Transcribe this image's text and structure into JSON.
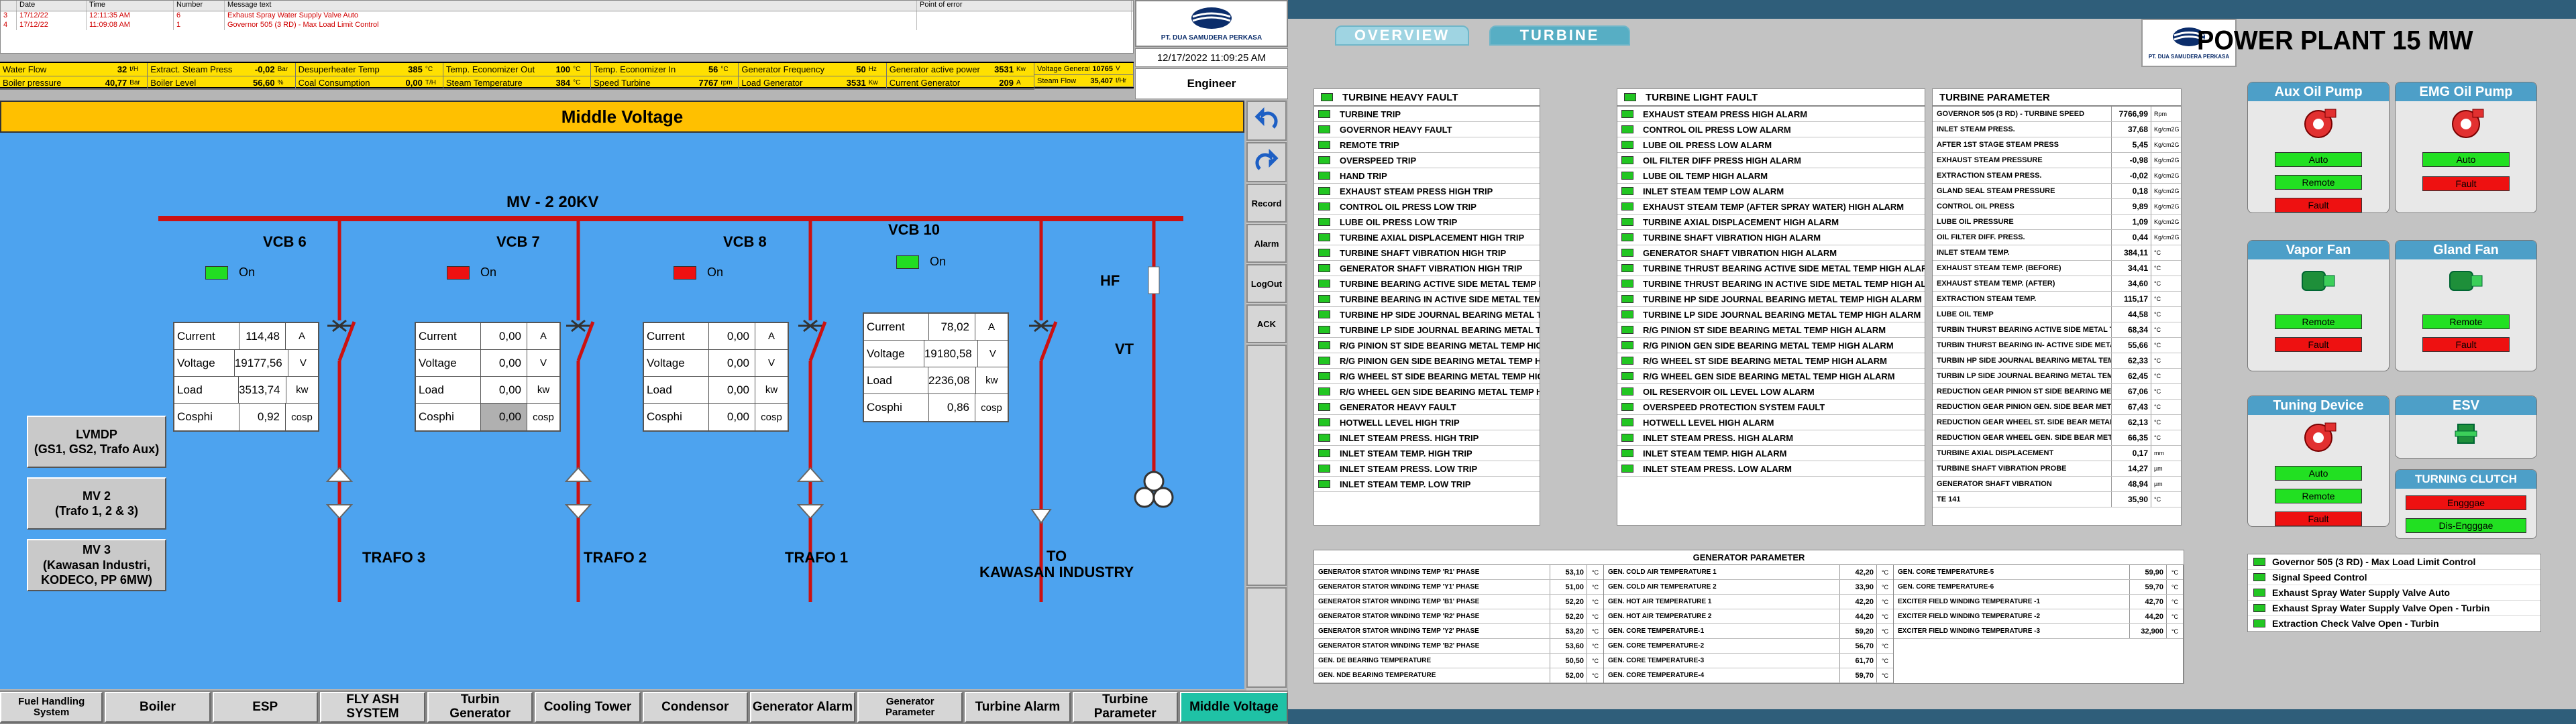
{
  "alarm_table": {
    "headers": [
      "",
      "Date",
      "Time",
      "Number",
      "Message text",
      "Point of error"
    ],
    "rows": [
      [
        "3",
        "17/12/22",
        "12:11:35 AM",
        "6",
        "Exhaust Spray Water Supply Valve Auto",
        ""
      ],
      [
        "4",
        "17/12/22",
        "11:09:08 AM",
        "1",
        "Governor 505 (3 RD) - Max Load Limit Control",
        ""
      ]
    ]
  },
  "kpis": [
    {
      "label": "Water Flow",
      "value": "32",
      "unit": "t/H"
    },
    {
      "label": "Extract. Steam Press",
      "value": "-0,02",
      "unit": "Bar"
    },
    {
      "label": "Desuperheater Temp",
      "value": "385",
      "unit": "°C"
    },
    {
      "label": "Temp. Economizer Out",
      "value": "100",
      "unit": "°C"
    },
    {
      "label": "Temp. Economizer In",
      "value": "56",
      "unit": "°C"
    },
    {
      "label": "Generator Frequency",
      "value": "50",
      "unit": "Hz"
    },
    {
      "label": "Generator active power",
      "value": "3531",
      "unit": "Kw"
    },
    {
      "label": "Boiler pressure",
      "value": "40,77",
      "unit": "Bar"
    },
    {
      "label": "Boiler Level",
      "value": "56,60",
      "unit": "%"
    },
    {
      "label": "Coal Consumption",
      "value": "0,00",
      "unit": "T/H"
    },
    {
      "label": "Steam Temperature",
      "value": "384",
      "unit": "°C"
    },
    {
      "label": "Speed Turbine",
      "value": "7767",
      "unit": "rpm"
    },
    {
      "label": "Load Generator",
      "value": "3531",
      "unit": "Kw"
    },
    {
      "label": "Current Generator",
      "value": "209",
      "unit": "A"
    }
  ],
  "kpi_extra": [
    {
      "label": "Voltage Generator",
      "value": "10765",
      "unit": "V"
    },
    {
      "label": "Steam Flow",
      "value": "35,407",
      "unit": "t/Hr"
    }
  ],
  "logo_text": "PT. DUA SAMUDERA PERKASA",
  "datetime": "12/17/2022 11:09:25 AM",
  "engineer": "Engineer",
  "mv_title": "Middle Voltage",
  "bus_label": "MV - 2   20KV",
  "vcbs": [
    {
      "label": "VCB 6",
      "state": "On",
      "color": "#22dd22"
    },
    {
      "label": "VCB 7",
      "state": "On",
      "color": "#ee1111"
    },
    {
      "label": "VCB 8",
      "state": "On",
      "color": "#ee1111"
    },
    {
      "label": "VCB 10",
      "state": "On",
      "color": "#22dd22"
    }
  ],
  "meters": [
    {
      "current": "114,48",
      "voltage": "19177,56",
      "load": "3513,74",
      "cosphi": "0,92"
    },
    {
      "current": "0,00",
      "voltage": "0,00",
      "load": "0,00",
      "cosphi": "0,00"
    },
    {
      "current": "0,00",
      "voltage": "0,00",
      "load": "0,00",
      "cosphi": "0,00"
    },
    {
      "current": "78,02",
      "voltage": "19180,58",
      "load": "2236,08",
      "cosphi": "0,86"
    }
  ],
  "meter_labels": {
    "current": "Current",
    "voltage": "Voltage",
    "load": "Load",
    "cosphi": "Cosphi"
  },
  "meter_units": {
    "current": "A",
    "voltage": "V",
    "load": "kw",
    "cosphi": "cosp"
  },
  "hf": "HF",
  "vt": "VT",
  "trafos": [
    "TRAFO 3",
    "TRAFO 2",
    "TRAFO 1",
    "TO\nKAWASAN INDUSTRY"
  ],
  "nav_panels": [
    "LVMDP\n(GS1, GS2, Trafo Aux)",
    "MV 2\n(Trafo 1, 2 & 3)",
    "MV 3\n(Kawasan Industri,\nKODECO, PP 6MW)"
  ],
  "sidebar": [
    "Record",
    "Alarm",
    "LogOut",
    "ACK"
  ],
  "navbar": [
    "Fuel Handling\nSystem",
    "Boiler",
    "ESP",
    "FLY ASH SYSTEM",
    "Turbin Generator",
    "Cooling Tower",
    "Condensor",
    "Generator Alarm",
    "Generator\nParameter",
    "Turbine Alarm",
    "Turbine Parameter",
    "Middle Voltage"
  ],
  "tabs": [
    "OVERVIEW",
    "TURBINE"
  ],
  "plant_title": "POWER PLANT 15 MW",
  "heavy_fault": {
    "title": "TURBINE HEAVY FAULT",
    "items": [
      "TURBINE TRIP",
      "GOVERNOR  HEAVY FAULT",
      "REMOTE TRIP",
      "OVERSPEED TRIP",
      "HAND TRIP",
      "EXHAUST STEAM PRESS HIGH TRIP",
      "CONTROL OIL PRESS LOW TRIP",
      "LUBE OIL PRESS LOW TRIP",
      "TURBINE AXIAL DISPLACEMENT HIGH TRIP",
      "TURBINE SHAFT VIBRATION HIGH TRIP",
      "GENERATOR SHAFT VIBRATION HIGH TRIP",
      "TURBINE BEARING ACTIVE SIDE METAL TEMP HIGH TRIP",
      "TURBINE BEARING IN ACTIVE SIDE METAL TEMP HIGH TRIP",
      "TURBINE HP SIDE JOURNAL BEARING METAL TEMP HIGH TRIP",
      "TURBINE LP SIDE JOURNAL BEARING METAL TEMP HIGH TRIP",
      "R/G PINION ST SIDE BEARING METAL TEMP HIGH TRIP",
      "R/G PINION GEN SIDE BEARING METAL TEMP HIGH TRIP",
      "R/G WHEEL ST SIDE BEARING METAL TEMP HIGH TRIP",
      "R/G WHEEL GEN SIDE BEARING METAL TEMP HIGH TRIP",
      "GENERATOR HEAVY FAULT",
      "HOTWELL LEVEL HIGH TRIP",
      "INLET STEAM PRESS. HIGH TRIP",
      "INLET STEAM TEMP. HIGH TRIP",
      "INLET STEAM PRESS. LOW TRIP",
      "INLET STEAM TEMP. LOW TRIP"
    ]
  },
  "light_fault": {
    "title": "TURBINE LIGHT FAULT",
    "items": [
      "EXHAUST STEAM PRESS HIGH ALARM",
      "CONTROL OIL PRESS LOW ALARM",
      "LUBE OIL PRESS LOW ALARM",
      "OIL FILTER DIFF PRESS HIGH ALARM",
      "LUBE OIL TEMP HIGH ALARM",
      "INLET STEAM TEMP LOW ALARM",
      "EXHAUST STEAM TEMP (AFTER SPRAY WATER) HIGH ALARM",
      "TURBINE AXIAL DISPLACEMENT HIGH ALARM",
      "TURBINE SHAFT VIBRATION HIGH ALARM",
      "GENERATOR SHAFT VIBRATION HIGH ALARM",
      "TURBINE THRUST BEARING ACTIVE SIDE METAL TEMP HIGH ALARM",
      "TURBINE THRUST BEARING IN ACTIVE SIDE METAL TEMP HIGH ALARM",
      "TURBINE HP SIDE JOURNAL BEARING METAL TEMP HIGH ALARM",
      "TURBINE LP SIDE JOURNAL BEARING METAL TEMP HIGH ALARM",
      "R/G PINION ST SIDE BEARING METAL TEMP HIGH ALARM",
      "R/G PINION GEN SIDE BEARING METAL TEMP HIGH ALARM",
      "R/G WHEEL ST SIDE BEARING METAL TEMP HIGH ALARM",
      "R/G WHEEL GEN SIDE BEARING METAL TEMP HIGH ALARM",
      "OIL RESERVOIR OIL LEVEL LOW ALARM",
      "OVERSPEED PROTECTION SYSTEM FAULT",
      "HOTWELL LEVEL HIGH ALARM",
      "INLET STEAM PRESS. HIGH ALARM",
      "INLET STEAM TEMP. HIGH ALARM",
      "INLET STEAM PRESS. LOW ALARM"
    ]
  },
  "turbine_param": {
    "title": "TURBINE PARAMETER",
    "rows": [
      [
        "GOVERNOR 505 (3 RD) - TURBINE SPEED",
        "7766,99",
        "Rpm"
      ],
      [
        "INLET STEAM PRESS.",
        "37,68",
        "Kg/cm2G"
      ],
      [
        "AFTER  1ST STAGE STEAM PRESS",
        "5,45",
        "Kg/cm2G"
      ],
      [
        "EXHAUST STEAM PRESSURE",
        "-0,98",
        "Kg/cm2G"
      ],
      [
        "EXTRACTION STEAM PRESS.",
        "-0,02",
        "Kg/cm2G"
      ],
      [
        "GLAND SEAL STEAM PRESSURE",
        "0,18",
        "Kg/cm2G"
      ],
      [
        "CONTROL OIL PRESS",
        "9,89",
        "Kg/cm2G"
      ],
      [
        "LUBE OIL PRESSURE",
        "1,09",
        "Kg/cm2G"
      ],
      [
        "OIL FILTER DIFF. PRESS.",
        "0,44",
        "Kg/cm2G"
      ],
      [
        "INLET STEAM TEMP.",
        "384,11",
        "°C"
      ],
      [
        "EXHAUST STEAM TEMP. (BEFORE)",
        "34,41",
        "°C"
      ],
      [
        "EXHAUST STEAM TEMP. (AFTER)",
        "34,60",
        "°C"
      ],
      [
        "EXTRACTION STEAM TEMP.",
        "115,17",
        "°C"
      ],
      [
        "LUBE OIL TEMP",
        "44,58",
        "°C"
      ],
      [
        "TURBIN THURST BEARING ACTIVE SIDE METAL TEMP",
        "68,34",
        "°C"
      ],
      [
        "TURBIN THURST BEARING IN- ACTIVE SIDE METAL TEMP",
        "55,66",
        "°C"
      ],
      [
        "TURBIN HP SIDE JOURNAL BEARING METAL TEMP",
        "62,33",
        "°C"
      ],
      [
        "TURBIN LP SIDE JOURNAL BEARING METAL TEMP",
        "62,45",
        "°C"
      ],
      [
        "REDUCTION GEAR PINION ST SIDE BEARING METAL TEMP",
        "67,06",
        "°C"
      ],
      [
        "REDUCTION GEAR PINION GEN. SIDE BEAR METAL TEMP",
        "67,43",
        "°C"
      ],
      [
        "REDUCTION GEAR WHEEL ST. SIDE BEAR METAL TEMP",
        "62,13",
        "°C"
      ],
      [
        "REDUCTION GEAR WHEEL GEN. SIDE BEAR METAL TEMP",
        "66,35",
        "°C"
      ],
      [
        "TURBINE AXIAL DISPLACEMENT",
        "0,17",
        "mm"
      ],
      [
        "TURBINE SHAFT VIBRATION PROBE",
        "14,27",
        "µm"
      ],
      [
        "GENERATOR SHAFT VIBRATION",
        "48,94",
        "µm"
      ],
      [
        "TE 141",
        "35,90",
        "°C"
      ]
    ]
  },
  "gen_param": {
    "title": "GENERATOR PARAMETER",
    "cols": [
      [
        [
          "GENERATOR STATOR WINDING TEMP 'R1' PHASE",
          "53,10"
        ],
        [
          "GENERATOR STATOR WINDING TEMP 'Y1' PHASE",
          "51,00"
        ],
        [
          "GENERATOR STATOR WINDING TEMP 'B1' PHASE",
          "52,20"
        ],
        [
          "GENERATOR STATOR WINDING TEMP 'R2' PHASE",
          "52,20"
        ],
        [
          "GENERATOR STATOR WINDING TEMP 'Y2' PHASE",
          "53,20"
        ],
        [
          "GENERATOR STATOR WINDING TEMP 'B2' PHASE",
          "53,60"
        ],
        [
          "GEN. DE BEARING TEMPERATURE",
          "50,50"
        ],
        [
          "GEN. NDE BEARING TEMPERATURE",
          "52,00"
        ]
      ],
      [
        [
          "GEN. COLD AIR TEMPERATURE 1",
          "42,20"
        ],
        [
          "GEN. COLD AIR TEMPERATURE 2",
          "33,90"
        ],
        [
          "GEN. HOT AIR TEMPERATURE 1",
          "42,20"
        ],
        [
          "GEN. HOT AIR TEMPERATURE 2",
          "44,20"
        ],
        [
          "GEN. CORE TEMPERATURE-1",
          "59,20"
        ],
        [
          "GEN. CORE TEMPERATURE-2",
          "56,70"
        ],
        [
          "GEN. CORE TEMPERATURE-3",
          "61,70"
        ],
        [
          "GEN. CORE TEMPERATURE-4",
          "59,70"
        ]
      ],
      [
        [
          "GEN. CORE TEMPERATURE-5",
          "59,90"
        ],
        [
          "GEN. CORE TEMPERATURE-6",
          "59,70"
        ],
        [
          "EXCITER FIELD WINDING TEMPERATURE -1",
          "42,70"
        ],
        [
          "EXCITER FIELD WINDING TEMPERATURE -2",
          "44,20"
        ],
        [
          "EXCITER FIELD WINDING TEMPERATURE -3",
          "32,900"
        ]
      ]
    ],
    "unit": "°C"
  },
  "equipment": [
    {
      "title": "Aux Oil Pump",
      "buttons": [
        [
          "Auto",
          "g"
        ],
        [
          "Remote",
          "g"
        ],
        [
          "Fault",
          "rd"
        ]
      ]
    },
    {
      "title": "EMG Oil Pump",
      "buttons": [
        [
          "Auto",
          "g"
        ],
        [
          "Fault",
          "rd"
        ]
      ]
    },
    {
      "title": "Vapor Fan",
      "buttons": [
        [
          "Remote",
          "g"
        ],
        [
          "Fault",
          "rd"
        ]
      ]
    },
    {
      "title": "Gland Fan",
      "buttons": [
        [
          "Remote",
          "g"
        ],
        [
          "Fault",
          "rd"
        ]
      ]
    },
    {
      "title": "Tuning Device",
      "buttons": [
        [
          "Auto",
          "g"
        ],
        [
          "Remote",
          "g"
        ],
        [
          "Fault",
          "rd"
        ]
      ]
    },
    {
      "title": "ESV",
      "buttons": []
    }
  ],
  "turning_clutch": {
    "title": "TURNING CLUTCH",
    "engage": "Engggae",
    "dis": "Dis-Engggae"
  },
  "indicators": [
    "Governor 505 (3 RD) - Max Load Limit Control",
    "Signal Speed Control",
    "Exhaust Spray Water Supply Valve Auto",
    "Exhaust Spray Water Supply Valve Open - Turbin",
    "Extraction Check Valve Open - Turbin"
  ]
}
